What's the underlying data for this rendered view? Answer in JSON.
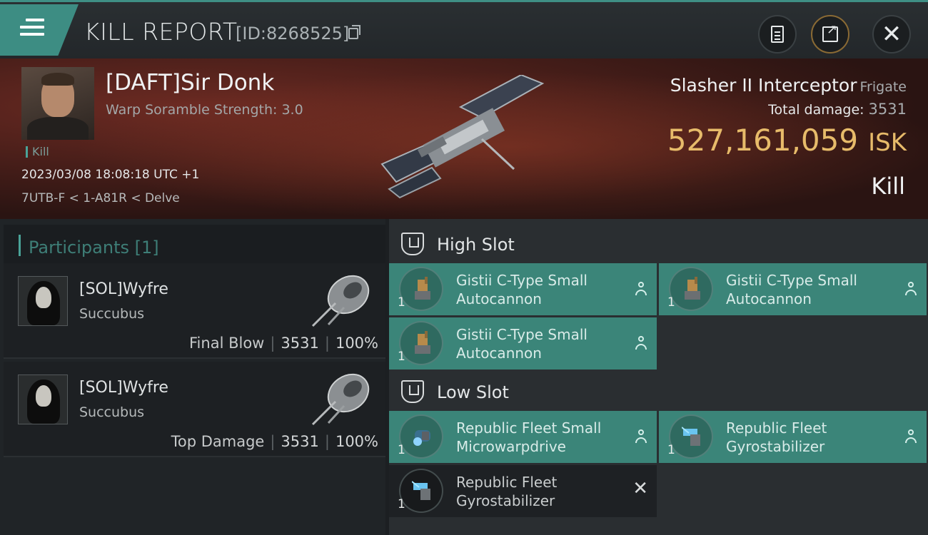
{
  "header": {
    "title": "KILL REPORT",
    "report_id": "[ID:8268525]",
    "menu_icon": "hamburger-menu-icon",
    "buttons": [
      "clipboard-icon",
      "share-icon",
      "close-icon"
    ],
    "close_glyph": "✕"
  },
  "victim": {
    "name": "[DAFT]Sir Donk",
    "subtitle": "Warp Soramble Strength: 3.0",
    "tag": "Kill",
    "datetime": "2023/03/08 18:08:18 UTC +1",
    "location": "7UTB-F < 1-A81R < Delve",
    "ship_name": "Slasher II Interceptor",
    "ship_class": "Frigate",
    "total_damage_label": "Total damage:",
    "total_damage": "3531",
    "isk_value": "527,161,059",
    "isk_unit": "ISK",
    "result": "Kill"
  },
  "participants": {
    "title": "Participants [1]",
    "rows": [
      {
        "name": "[SOL]Wyfre",
        "ship": "Succubus",
        "label": "Final Blow",
        "damage": "3531",
        "percent": "100%"
      },
      {
        "name": "[SOL]Wyfre",
        "ship": "Succubus",
        "label": "Top Damage",
        "damage": "3531",
        "percent": "100%"
      }
    ]
  },
  "fitting": {
    "high_slot": {
      "title": "High Slot",
      "modules": [
        {
          "name_line1": "Gistii C-Type Small",
          "name_line2": "Autocannon",
          "qty": "1"
        },
        {
          "name_line1": "Gistii C-Type Small",
          "name_line2": "Autocannon",
          "qty": "1"
        },
        {
          "name_line1": "Gistii C-Type Small",
          "name_line2": "Autocannon",
          "qty": "1"
        }
      ]
    },
    "low_slot": {
      "title": "Low Slot",
      "modules": [
        {
          "name_line1": "Republic Fleet Small",
          "name_line2": "Microwarpdrive",
          "qty": "1"
        },
        {
          "name_line1": "Republic Fleet",
          "name_line2": "Gyrostabilizer",
          "qty": "1"
        },
        {
          "name_line1": "Republic Fleet",
          "name_line2": "Gyrostabilizer",
          "qty": "1"
        }
      ]
    }
  },
  "colors": {
    "accent": "#3d8d83",
    "isk": "#e7bb6a",
    "dropped_module": "#3b8579",
    "destroyed_module": "#1e2124"
  }
}
